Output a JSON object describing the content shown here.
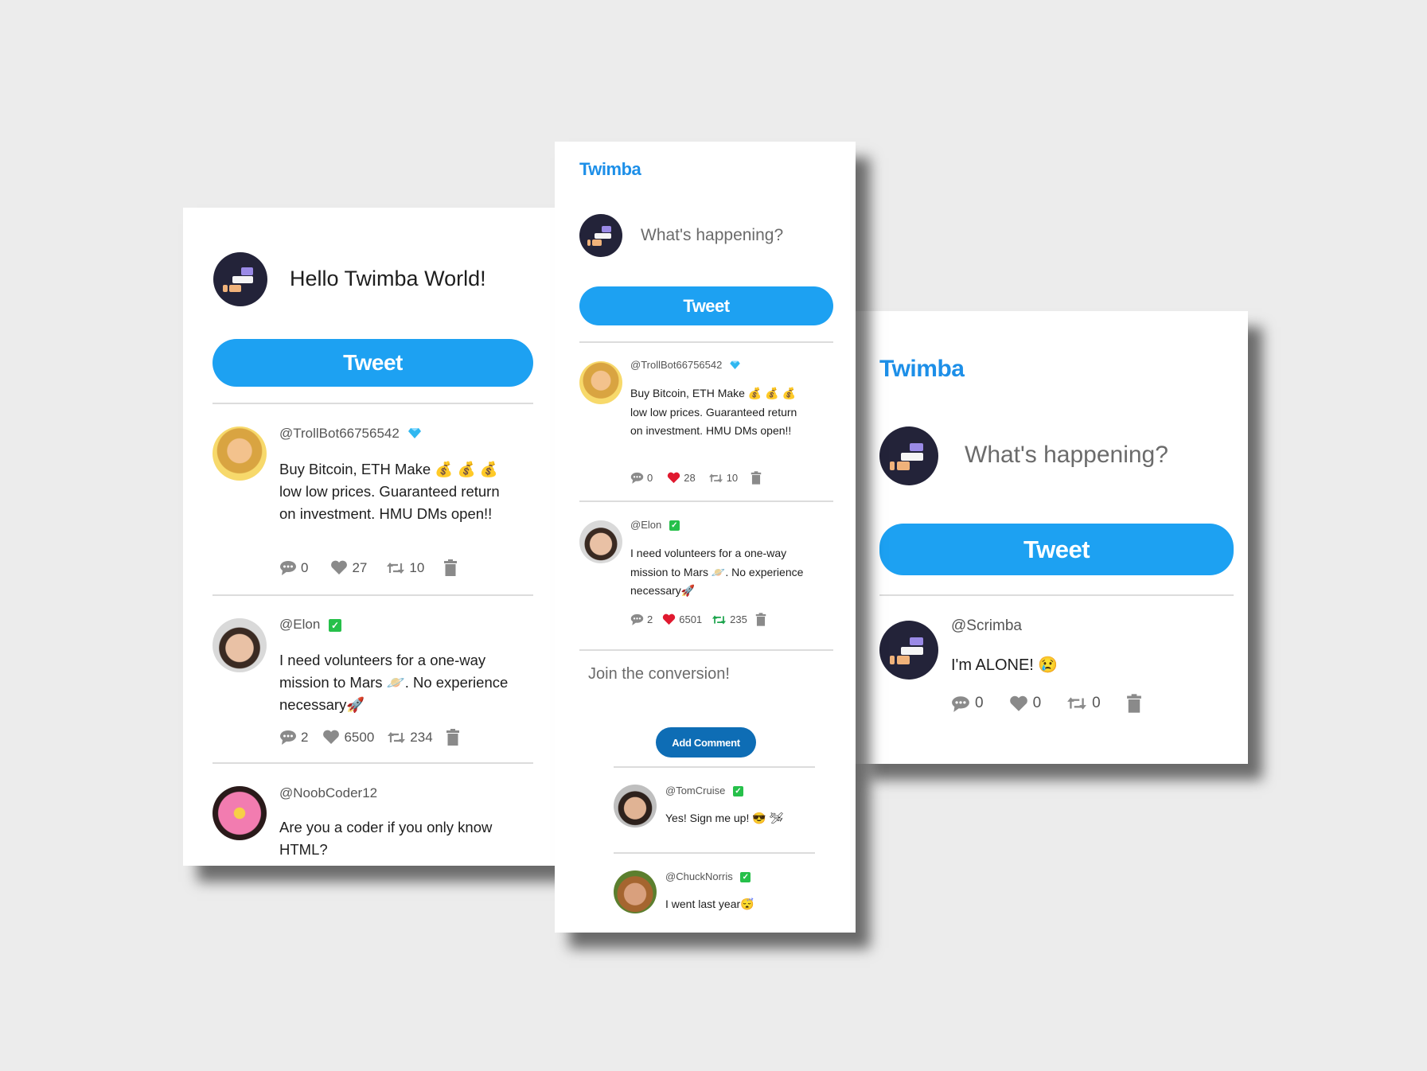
{
  "colors": {
    "accent": "#1da1f2",
    "brand": "#1d8fe8",
    "logo_bg": "#232339",
    "heart": "#e0192f",
    "retweet": "#19a34a",
    "verified": "#26c04a",
    "add_comment": "#0e6db5"
  },
  "left": {
    "compose_text": "Hello Twimba World!",
    "tweet_button": "Tweet",
    "tweets": [
      {
        "handle": "@TrollBot66756542",
        "text": "Buy Bitcoin, ETH Make 💰 💰 💰 low low prices. Guaranteed return on investment. HMU DMs open!!",
        "replies": "0",
        "likes": "27",
        "retweets": "10",
        "badge": "diamond-icon"
      },
      {
        "handle": "@Elon",
        "text": "I need volunteers for a one-way mission to Mars 🪐. No experience necessary🚀",
        "replies": "2",
        "likes": "6500",
        "retweets": "234",
        "badge": "verified-check-icon"
      },
      {
        "handle": "@NoobCoder12",
        "text": "Are you a coder if you only know HTML?"
      }
    ]
  },
  "middle": {
    "brand": "Twimba",
    "compose_placeholder": "What's happening?",
    "tweet_button": "Tweet",
    "tweets": [
      {
        "handle": "@TrollBot66756542",
        "text": "Buy Bitcoin, ETH Make 💰 💰 💰 low low prices. Guaranteed return on investment. HMU DMs open!!",
        "replies": "0",
        "likes": "28",
        "retweets": "10",
        "badge": "diamond-icon"
      },
      {
        "handle": "@Elon",
        "text": "I need volunteers for a one-way mission to Mars 🪐. No experience necessary🚀",
        "replies": "2",
        "likes": "6501",
        "retweets": "235",
        "badge": "verified-check-icon"
      }
    ],
    "comment_placeholder": "Join the conversion!",
    "add_comment_button": "Add Comment",
    "replies": [
      {
        "handle": "@TomCruise",
        "text": "Yes! Sign me up! 😎 🛩"
      },
      {
        "handle": "@ChuckNorris",
        "text": "I went last year😴"
      }
    ]
  },
  "right": {
    "brand": "Twimba",
    "compose_placeholder": "What's happening?",
    "tweet_button": "Tweet",
    "tweets": [
      {
        "handle": "@Scrimba",
        "text": "I'm ALONE! 😢",
        "replies": "0",
        "likes": "0",
        "retweets": "0"
      }
    ]
  }
}
